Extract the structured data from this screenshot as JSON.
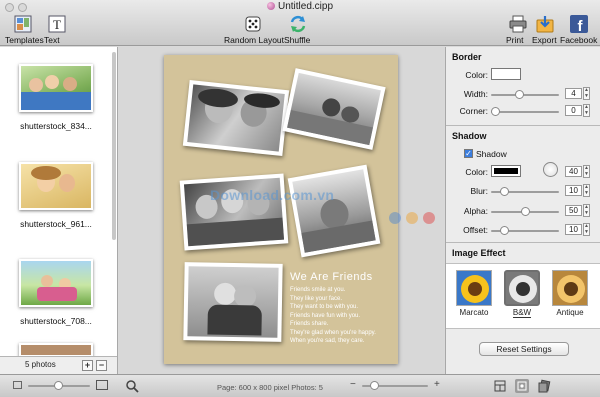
{
  "window": {
    "title": "Untitled.cipp"
  },
  "toolbar": {
    "templates_label": "Templates",
    "text_label": "Text",
    "random_layout_label": "Random Layout",
    "shuffle_label": "Shuffle",
    "print_label": "Print",
    "export_label": "Export",
    "facebook_label": "Facebook"
  },
  "sidebar": {
    "photos": [
      {
        "caption": "shutterstock_834..."
      },
      {
        "caption": "shutterstock_961..."
      },
      {
        "caption": "shutterstock_708..."
      }
    ],
    "photo_count": "5 photos",
    "add_label": "+",
    "remove_label": "−"
  },
  "canvas": {
    "heading": "We Are Friends",
    "poem": [
      "Friends smile at you.",
      "They like your face.",
      "They want to be with you.",
      "Friends have fun with you.",
      "Friends share.",
      "They're glad when you're happy.",
      "When you're sad, they care."
    ],
    "watermark": "Download.com.vn",
    "background_color": "#d3c39a"
  },
  "inspector": {
    "border": {
      "heading": "Border",
      "color_label": "Color:",
      "color": "#ffffff",
      "width_label": "Width:",
      "width_value": "4",
      "corner_label": "Corner:",
      "corner_value": "0"
    },
    "shadow": {
      "heading": "Shadow",
      "enabled_label": "Shadow",
      "color_label": "Color:",
      "color": "#000000",
      "angle_value": "40",
      "blur_label": "Blur:",
      "blur_value": "10",
      "alpha_label": "Alpha:",
      "alpha_value": "50",
      "offset_label": "Offset:",
      "offset_value": "10"
    },
    "image_effect": {
      "heading": "Image Effect",
      "effects": [
        {
          "label": "Marcato",
          "selected": false
        },
        {
          "label": "B&W",
          "selected": true
        },
        {
          "label": "Antique",
          "selected": false
        }
      ]
    },
    "reset_label": "Reset Settings"
  },
  "bottombar": {
    "page_info": "Page: 600 x 800 pixel Photos: 5"
  }
}
